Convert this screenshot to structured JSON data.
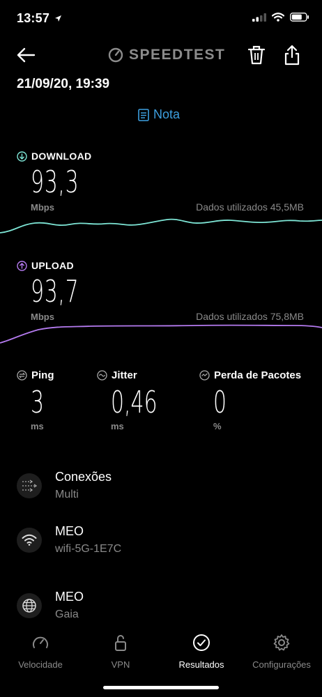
{
  "status": {
    "time": "13:57"
  },
  "header": {
    "logo": "SPEEDTEST",
    "date": "21/09/20, 19:39",
    "note": "Nota"
  },
  "download": {
    "label": "DOWNLOAD",
    "value": "93,3",
    "unit": "Mbps",
    "data_used": "Dados utilizados 45,5MB",
    "color": "#7ee6d6"
  },
  "upload": {
    "label": "UPLOAD",
    "value": "93,7",
    "unit": "Mbps",
    "data_used": "Dados utilizados 75,8MB",
    "color": "#b57bf0"
  },
  "metrics": [
    {
      "label": "Ping",
      "value": "3",
      "unit": "ms"
    },
    {
      "label": "Jitter",
      "value": "0,46",
      "unit": "ms"
    },
    {
      "label": "Perda de Pacotes",
      "value": "0",
      "unit": "%"
    }
  ],
  "info": [
    {
      "title": "Conexões",
      "sub": "Multi",
      "icon": "connections-icon"
    },
    {
      "title": "MEO",
      "sub": "wifi-5G-1E7C",
      "icon": "wifi-icon"
    },
    {
      "title": "MEO",
      "sub": "Gaia",
      "icon": "globe-icon"
    }
  ],
  "nav": [
    {
      "label": "Velocidade",
      "icon": "speedometer-icon",
      "active": false
    },
    {
      "label": "VPN",
      "icon": "lock-icon",
      "active": false
    },
    {
      "label": "Resultados",
      "icon": "check-circle-icon",
      "active": true
    },
    {
      "label": "Configurações",
      "icon": "gear-icon",
      "active": false
    }
  ]
}
